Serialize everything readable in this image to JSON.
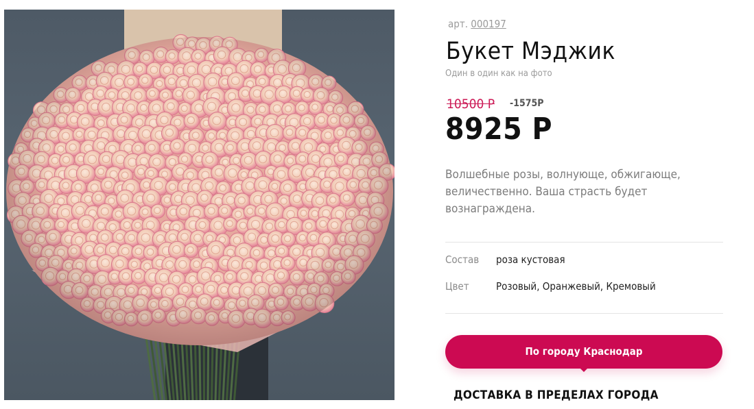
{
  "product": {
    "sku_label": "арт.",
    "sku_value": "000197",
    "title": "Букет Мэджик",
    "subtitle": "Один в один как на фото",
    "old_price": "10500 Р",
    "discount": "-1575Р",
    "price": "8925 Р",
    "description": "Волшебные розы, волнующе, обжигающе, величественно. Ваша страсть будет вознаграждена."
  },
  "attributes": [
    {
      "label": "Состав",
      "value": "роза кустовая"
    },
    {
      "label": "Цвет",
      "value": "Розовый, Оранжевый, Кремовый"
    }
  ],
  "delivery": {
    "city_button_label": "По городу Краснодар",
    "heading": "ДОСТАВКА В ПРЕДЕЛАХ ГОРОДА"
  },
  "colors": {
    "accent": "#cc0a52",
    "old_price": "#cc1b57",
    "photo_background": "#566370",
    "rose_cream": "#f3d6c3",
    "rose_pink": "#e4788c"
  }
}
